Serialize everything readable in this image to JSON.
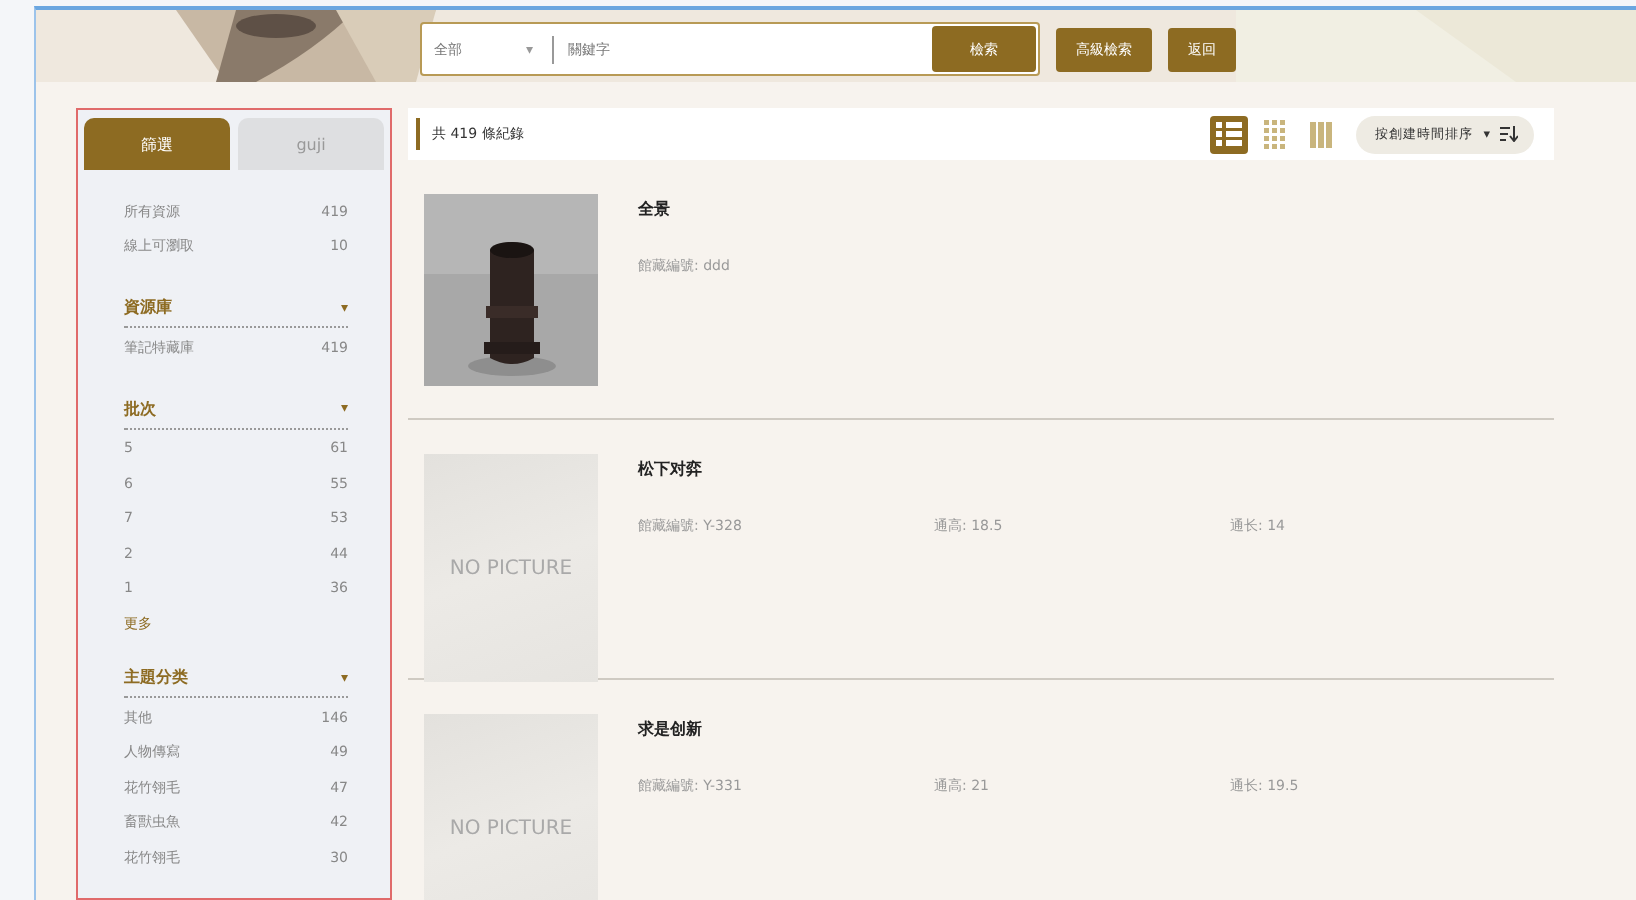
{
  "search": {
    "scope": "全部",
    "scope_caret": "▾",
    "placeholder": "關鍵字",
    "buttons": [
      "檢索",
      "高級檢索",
      "返回"
    ]
  },
  "sidebar": {
    "tabs": [
      {
        "label": "篩選",
        "selected": true
      },
      {
        "label": "guji",
        "selected": false
      }
    ],
    "summary": [
      {
        "label": "所有資源",
        "count": "419"
      },
      {
        "label": "線上可瀏取",
        "count": "10"
      }
    ],
    "groups": [
      {
        "title": "資源庫",
        "toggle": "▾",
        "items": [
          {
            "label": "筆記特藏庫",
            "count": "419"
          }
        ]
      },
      {
        "title": "批次",
        "toggle": "▾",
        "items": [
          {
            "label": "5",
            "count": "61"
          },
          {
            "label": "6",
            "count": "55"
          },
          {
            "label": "7",
            "count": "53"
          },
          {
            "label": "2",
            "count": "44"
          },
          {
            "label": "1",
            "count": "36"
          }
        ],
        "more": "更多"
      },
      {
        "title": "主題分类",
        "toggle": "▾",
        "items": [
          {
            "label": "其他",
            "count": "146"
          },
          {
            "label": "人物傳寫",
            "count": "49"
          },
          {
            "label": "花竹翎毛",
            "count": "47"
          },
          {
            "label": "畜獸虫魚",
            "count": "42"
          },
          {
            "label": "花竹翎毛",
            "count": "30"
          }
        ]
      }
    ]
  },
  "results": {
    "total": "共 419 條紀錄",
    "views": [
      {
        "kind": "list",
        "selected": true
      },
      {
        "kind": "grid",
        "selected": false
      },
      {
        "kind": "columns",
        "selected": false
      }
    ],
    "sort": {
      "label": "按創建時間排序",
      "caret": "▾"
    },
    "items": [
      {
        "title": "全景",
        "image": {
          "kind": "picture"
        },
        "fields": [
          "館藏編號: ddd"
        ]
      },
      {
        "title": "松下对弈",
        "image": {
          "kind": "placeholder",
          "label": "NO PICTURE"
        },
        "fields": [
          "館藏編號: Y-328",
          "通高: 18.5",
          "通长: 14"
        ]
      },
      {
        "title": "求是创新",
        "image": {
          "kind": "placeholder",
          "label": "NO PICTURE"
        },
        "fields": [
          "館藏編號: Y-331",
          "通高: 21",
          "通长: 19.5"
        ]
      }
    ]
  }
}
